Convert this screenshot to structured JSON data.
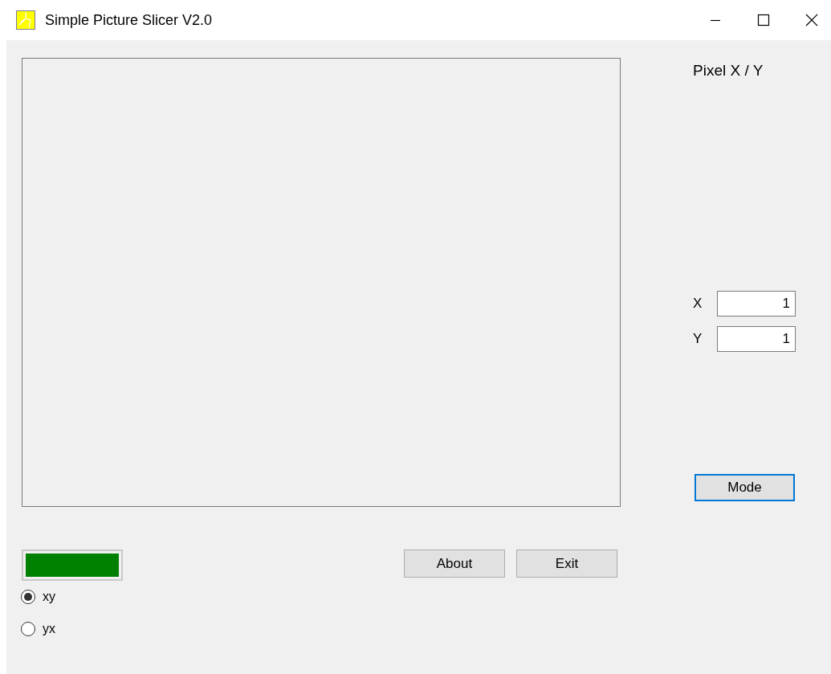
{
  "window": {
    "title": "Simple Picture Slicer V2.0"
  },
  "pixel_label": "Pixel X / Y",
  "fields": [
    {
      "label": "X",
      "value": "1"
    },
    {
      "label": "Y",
      "value": "1"
    }
  ],
  "mode_button": {
    "label": "Mode",
    "focused": true
  },
  "progress": {
    "level": 1
  },
  "buttons": [
    "About",
    "Exit"
  ],
  "order": [
    {
      "label": "xy",
      "selected": true
    },
    {
      "label": "yx",
      "selected": false
    }
  ]
}
